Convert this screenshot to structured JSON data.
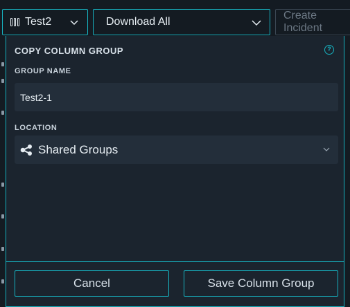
{
  "toolbar": {
    "group_label": "Test2",
    "download_label": "Download All",
    "incident_label": "Create Incident"
  },
  "modal": {
    "title": "COPY COLUMN GROUP",
    "group_name_label": "GROUP NAME",
    "group_name_value": "Test2-1",
    "location_label": "LOCATION",
    "location_value": "Shared Groups",
    "cancel_label": "Cancel",
    "save_label": "Save Column Group"
  },
  "colors": {
    "accent": "#17b3c1",
    "background": "#141b22",
    "panel": "#1b242e",
    "input": "#232e3a"
  }
}
